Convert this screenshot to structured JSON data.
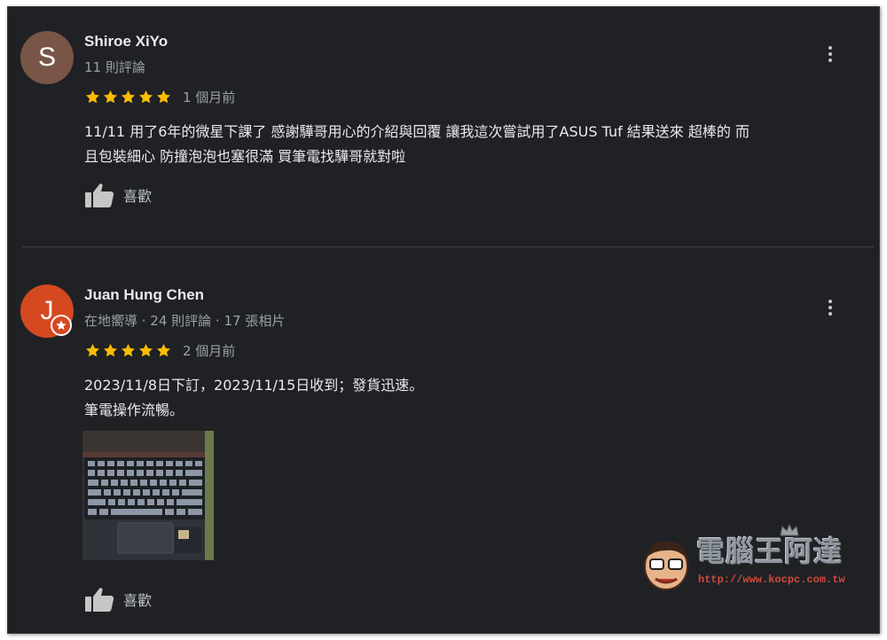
{
  "reviews": [
    {
      "avatar_letter": "S",
      "name": "Shiroe XiYo",
      "meta": "11 則評論",
      "rating": 5,
      "time": "1 個月前",
      "text_lines": [
        "11/11 用了6年的微星下課了 感謝驊哥用心的介紹與回覆 讓我這次嘗試用了ASUS Tuf 結果送來 超棒的 而",
        "且包裝細心 防撞泡泡也塞很滿 買筆電找驊哥就對啦"
      ],
      "like_label": "喜歡"
    },
    {
      "avatar_letter": "J",
      "name": "Juan Hung Chen",
      "meta": "在地嚮導 · 24 則評論 · 17 張相片",
      "rating": 5,
      "time": "2 個月前",
      "text_lines": [
        "2023/11/8日下訂，2023/11/15日收到；發貨迅速。",
        "筆電操作流暢。"
      ],
      "like_label": "喜歡"
    }
  ],
  "icons": {
    "star": "star-icon",
    "more": "more-vert-icon",
    "like": "thumb-up-icon",
    "badge": "local-guide-badge-icon"
  },
  "colors": {
    "background": "#202124",
    "star": "#fbbc04",
    "text": "#e8eaed",
    "secondary_text": "#9aa0a6",
    "avatar_1": "#795548",
    "avatar_2": "#d44920"
  },
  "watermark": {
    "title": "電腦王阿達",
    "url": "http://www.kocpc.com.tw"
  }
}
